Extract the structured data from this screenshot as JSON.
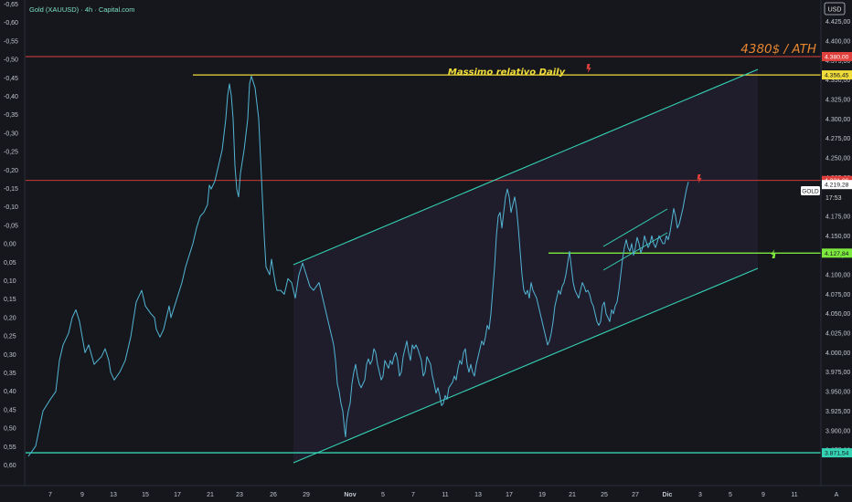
{
  "header": {
    "title": "Gold (XAUUSD) · 4h · Capital.com",
    "currency": "USD"
  },
  "colors": {
    "bg": "#16171d",
    "price": "#52b6d4",
    "channel": "#34d3b4",
    "red": "#e0403c",
    "yellow": "#f0dc3a",
    "green": "#7de83e",
    "orange": "#e8862f"
  },
  "annotations": {
    "ath_text": "4380$ / ATH",
    "daily_text": "Massimo relativo Daily",
    "symbol_label": "GOLD",
    "countdown": "17:53",
    "corner_label": "A"
  },
  "chart_data": {
    "type": "line",
    "title": "Gold (XAUUSD) · 4h · Capital.com",
    "ylim": [
      3860,
      4437
    ],
    "y_ticks": [
      3875,
      3900,
      3925,
      3950,
      3975,
      4000,
      4025,
      4050,
      4075,
      4100,
      4125,
      4150,
      4175,
      4200,
      4225,
      4250,
      4275,
      4300,
      4325,
      4350,
      4375,
      4400,
      4425
    ],
    "y_tick_labels": [
      "3.875,00",
      "3.900,00",
      "3.925,00",
      "3.950,00",
      "3.975,00",
      "4.000,00",
      "4.025,00",
      "4.050,00",
      "4.075,00",
      "4.100,00",
      "4.125,00",
      "4.150,00",
      "4.175,00",
      "4.200,00",
      "4.225,00",
      "4.250,00",
      "4.275,00",
      "4.300,00",
      "4.325,00",
      "4.350,00",
      "4.375,00",
      "4.400,00",
      "4.425,00"
    ],
    "left_axis": {
      "values": [
        -0.65,
        -0.6,
        -0.55,
        -0.5,
        -0.45,
        -0.4,
        -0.35,
        -0.3,
        -0.25,
        -0.2,
        -0.15,
        -0.1,
        -0.05,
        0.0,
        0.05,
        0.1,
        0.15,
        0.2,
        0.25,
        0.3,
        0.35,
        0.4,
        0.45,
        0.5,
        0.55,
        0.6
      ],
      "labels": [
        "-0,65",
        "-0,60",
        "-0,55",
        "-0,50",
        "-0,45",
        "-0,40",
        "-0,35",
        "-0,30",
        "-0,25",
        "-0,20",
        "-0,15",
        "-0,10",
        "-0,05",
        "0,00",
        "0,05",
        "0,10",
        "0,15",
        "0,20",
        "0,25",
        "0,30",
        "0,35",
        "0,40",
        "0,45",
        "0,50",
        "0,55",
        "0,60"
      ]
    },
    "x_labels": [
      "7",
      "9",
      "13",
      "15",
      "17",
      "21",
      "23",
      "26",
      "29",
      "Nov",
      "5",
      "7",
      "11",
      "13",
      "17",
      "19",
      "21",
      "25",
      "27",
      "Dic",
      "3",
      "5",
      "9",
      "11"
    ],
    "series": [
      {
        "name": "Gold (XAUUSD)",
        "points": [
          [
            0,
            3867
          ],
          [
            4,
            3880
          ],
          [
            8,
            3925
          ],
          [
            12,
            3940
          ],
          [
            15,
            3950
          ],
          [
            17,
            3990
          ],
          [
            19,
            4010
          ],
          [
            22,
            4025
          ],
          [
            24,
            4045
          ],
          [
            26,
            4055
          ],
          [
            28,
            4040
          ],
          [
            31,
            4000
          ],
          [
            33,
            4010
          ],
          [
            36,
            3985
          ],
          [
            38,
            3990
          ],
          [
            40,
            3995
          ],
          [
            42,
            4005
          ],
          [
            44,
            3990
          ],
          [
            45,
            3975
          ],
          [
            47,
            3965
          ],
          [
            50,
            3975
          ],
          [
            53,
            3990
          ],
          [
            56,
            4020
          ],
          [
            59,
            4065
          ],
          [
            62,
            4080
          ],
          [
            64,
            4060
          ],
          [
            67,
            4050
          ],
          [
            69,
            4045
          ],
          [
            70,
            4030
          ],
          [
            72,
            4020
          ],
          [
            74,
            4030
          ],
          [
            77,
            4060
          ],
          [
            78,
            4045
          ],
          [
            80,
            4060
          ],
          [
            82,
            4075
          ],
          [
            84,
            4090
          ],
          [
            86,
            4110
          ],
          [
            88,
            4125
          ],
          [
            90,
            4140
          ],
          [
            92,
            4160
          ],
          [
            94,
            4175
          ],
          [
            96,
            4180
          ],
          [
            98,
            4190
          ],
          [
            99,
            4215
          ],
          [
            100,
            4210
          ],
          [
            102,
            4220
          ],
          [
            104,
            4240
          ],
          [
            106,
            4260
          ],
          [
            108,
            4300
          ],
          [
            109,
            4330
          ],
          [
            110,
            4345
          ],
          [
            111,
            4330
          ],
          [
            112,
            4300
          ],
          [
            113,
            4240
          ],
          [
            114,
            4210
          ],
          [
            115,
            4200
          ],
          [
            116,
            4230
          ],
          [
            118,
            4260
          ],
          [
            120,
            4300
          ],
          [
            121,
            4345
          ],
          [
            122,
            4355
          ],
          [
            124,
            4340
          ],
          [
            125,
            4320
          ],
          [
            126,
            4300
          ],
          [
            127,
            4250
          ],
          [
            128,
            4200
          ],
          [
            129,
            4150
          ],
          [
            130,
            4110
          ],
          [
            132,
            4100
          ],
          [
            133,
            4120
          ],
          [
            134,
            4105
          ],
          [
            135,
            4090
          ],
          [
            136,
            4080
          ],
          [
            138,
            4080
          ],
          [
            140,
            4075
          ],
          [
            142,
            4095
          ],
          [
            144,
            4090
          ],
          [
            146,
            4070
          ],
          [
            148,
            4100
          ],
          [
            150,
            4115
          ],
          [
            152,
            4100
          ],
          [
            154,
            4085
          ],
          [
            156,
            4080
          ],
          [
            159,
            4090
          ],
          [
            160,
            4080
          ],
          [
            162,
            4060
          ],
          [
            164,
            4040
          ],
          [
            165,
            4030
          ],
          [
            166,
            4020
          ],
          [
            167,
            4010
          ],
          [
            168,
            3990
          ],
          [
            169,
            3960
          ],
          [
            170,
            3950
          ],
          [
            171,
            3935
          ],
          [
            172,
            3925
          ],
          [
            173,
            3900
          ],
          [
            173.5,
            3892
          ],
          [
            174,
            3910
          ],
          [
            175,
            3925
          ],
          [
            176,
            3935
          ],
          [
            177,
            3960
          ],
          [
            178,
            3975
          ],
          [
            179,
            3985
          ],
          [
            180,
            3970
          ],
          [
            181,
            3960
          ],
          [
            182,
            3955
          ],
          [
            183,
            3960
          ],
          [
            184,
            3965
          ],
          [
            185,
            3985
          ],
          [
            186,
            3992
          ],
          [
            187,
            3985
          ],
          [
            188,
            3990
          ],
          [
            189,
            4005
          ],
          [
            190,
            4000
          ],
          [
            191,
            3985
          ],
          [
            192,
            3975
          ],
          [
            193,
            3965
          ],
          [
            194,
            3970
          ],
          [
            195,
            3990
          ],
          [
            196,
            3985
          ],
          [
            197,
            3980
          ],
          [
            198,
            3990
          ],
          [
            199,
            3985
          ],
          [
            200,
            3995
          ],
          [
            201,
            4000
          ],
          [
            202,
            3990
          ],
          [
            203,
            3970
          ],
          [
            204,
            3975
          ],
          [
            205,
            3995
          ],
          [
            206,
            4005
          ],
          [
            207,
            4015
          ],
          [
            208,
            4000
          ],
          [
            209,
            3990
          ],
          [
            210,
            4010
          ],
          [
            211,
            4005
          ],
          [
            212,
            4010
          ],
          [
            213,
            4005
          ],
          [
            215,
            3990
          ],
          [
            216,
            3970
          ],
          [
            217,
            3975
          ],
          [
            218,
            3995
          ],
          [
            219,
            3990
          ],
          [
            220,
            3985
          ],
          [
            221,
            3970
          ],
          [
            222,
            3960
          ],
          [
            223,
            3948
          ],
          [
            224,
            3955
          ],
          [
            225,
            3945
          ],
          [
            226,
            3932
          ],
          [
            227,
            3935
          ],
          [
            228,
            3945
          ],
          [
            229,
            3940
          ],
          [
            230,
            3955
          ],
          [
            232,
            3962
          ],
          [
            233,
            3970
          ],
          [
            234,
            3965
          ],
          [
            235,
            3980
          ],
          [
            236,
            3990
          ],
          [
            237,
            3985
          ],
          [
            238,
            4000
          ],
          [
            239,
            4005
          ],
          [
            240,
            3985
          ],
          [
            241,
            3975
          ],
          [
            242,
            3985
          ],
          [
            243,
            3975
          ],
          [
            244,
            3970
          ],
          [
            245,
            3985
          ],
          [
            246,
            3995
          ],
          [
            247,
            4005
          ],
          [
            248,
            4015
          ],
          [
            249,
            4010
          ],
          [
            250,
            4020
          ],
          [
            251,
            4035
          ],
          [
            252,
            4030
          ],
          [
            253,
            4050
          ],
          [
            254,
            4080
          ],
          [
            255,
            4110
          ],
          [
            256,
            4150
          ],
          [
            257,
            4175
          ],
          [
            258,
            4180
          ],
          [
            259,
            4160
          ],
          [
            260,
            4180
          ],
          [
            261,
            4200
          ],
          [
            262,
            4210
          ],
          [
            263,
            4200
          ],
          [
            264,
            4180
          ],
          [
            265,
            4190
          ],
          [
            266,
            4200
          ],
          [
            267,
            4185
          ],
          [
            268,
            4160
          ],
          [
            269,
            4130
          ],
          [
            270,
            4100
          ],
          [
            271,
            4080
          ],
          [
            272,
            4075
          ],
          [
            273,
            4080
          ],
          [
            274,
            4070
          ],
          [
            275,
            4090
          ],
          [
            276,
            4080
          ],
          [
            277,
            4075
          ],
          [
            278,
            4070
          ],
          [
            279,
            4060
          ],
          [
            280,
            4050
          ],
          [
            281,
            4040
          ],
          [
            282,
            4030
          ],
          [
            283,
            4020
          ],
          [
            284,
            4010
          ],
          [
            285,
            4015
          ],
          [
            286,
            4025
          ],
          [
            287,
            4040
          ],
          [
            288,
            4060
          ],
          [
            289,
            4070
          ],
          [
            290,
            4080
          ],
          [
            291,
            4075
          ],
          [
            292,
            4085
          ],
          [
            293,
            4090
          ],
          [
            294,
            4100
          ],
          [
            295,
            4115
          ],
          [
            296,
            4130
          ],
          [
            297,
            4110
          ],
          [
            298,
            4090
          ],
          [
            299,
            4080
          ],
          [
            300,
            4075
          ],
          [
            301,
            4070
          ],
          [
            302,
            4080
          ],
          [
            303,
            4090
          ],
          [
            304,
            4085
          ],
          [
            305,
            4078
          ],
          [
            306,
            4080
          ],
          [
            307,
            4075
          ],
          [
            308,
            4065
          ],
          [
            309,
            4060
          ],
          [
            310,
            4050
          ],
          [
            311,
            4040
          ],
          [
            312,
            4035
          ],
          [
            313,
            4040
          ],
          [
            314,
            4060
          ],
          [
            315,
            4065
          ],
          [
            316,
            4050
          ],
          [
            317,
            4045
          ],
          [
            318,
            4040
          ],
          [
            319,
            4055
          ],
          [
            320,
            4050
          ],
          [
            321,
            4060
          ],
          [
            322,
            4065
          ],
          [
            323,
            4080
          ],
          [
            324,
            4100
          ],
          [
            325,
            4120
          ],
          [
            326,
            4135
          ],
          [
            327,
            4145
          ],
          [
            328,
            4135
          ],
          [
            329,
            4130
          ],
          [
            330,
            4140
          ],
          [
            331,
            4125
          ],
          [
            332,
            4135
          ],
          [
            333,
            4148
          ],
          [
            334,
            4140
          ],
          [
            335,
            4128
          ],
          [
            336,
            4135
          ],
          [
            337,
            4150
          ],
          [
            338,
            4142
          ],
          [
            339,
            4135
          ],
          [
            340,
            4140
          ],
          [
            341,
            4150
          ],
          [
            342,
            4140
          ],
          [
            343,
            4135
          ],
          [
            344,
            4142
          ],
          [
            345,
            4150
          ],
          [
            346,
            4145
          ],
          [
            347,
            4140
          ],
          [
            348,
            4140
          ],
          [
            349,
            4150
          ],
          [
            350,
            4145
          ],
          [
            351,
            4155
          ],
          [
            352,
            4170
          ],
          [
            353,
            4185
          ],
          [
            354,
            4175
          ],
          [
            355,
            4160
          ],
          [
            356,
            4165
          ],
          [
            357,
            4175
          ],
          [
            358,
            4185
          ],
          [
            359,
            4198
          ],
          [
            360,
            4210
          ],
          [
            361,
            4219.28
          ]
        ]
      }
    ],
    "horizontal_levels": [
      {
        "value": 4380.0,
        "label": "4.380,00",
        "color": "#e0403c"
      },
      {
        "value": 4356.45,
        "label": "4.356,45",
        "color": "#f0dc3a"
      },
      {
        "value": 4221.06,
        "label": "4.221,06",
        "color": "#e0403c"
      },
      {
        "value": 4219.28,
        "label": "4.219,28",
        "color": "#ffffff"
      },
      {
        "value": 4127.84,
        "label": "4.127,84",
        "color": "#7de83e"
      },
      {
        "value": 3871.54,
        "label": "3.871,54",
        "color": "#34d3b4"
      }
    ],
    "legend": "none",
    "grid": false
  }
}
